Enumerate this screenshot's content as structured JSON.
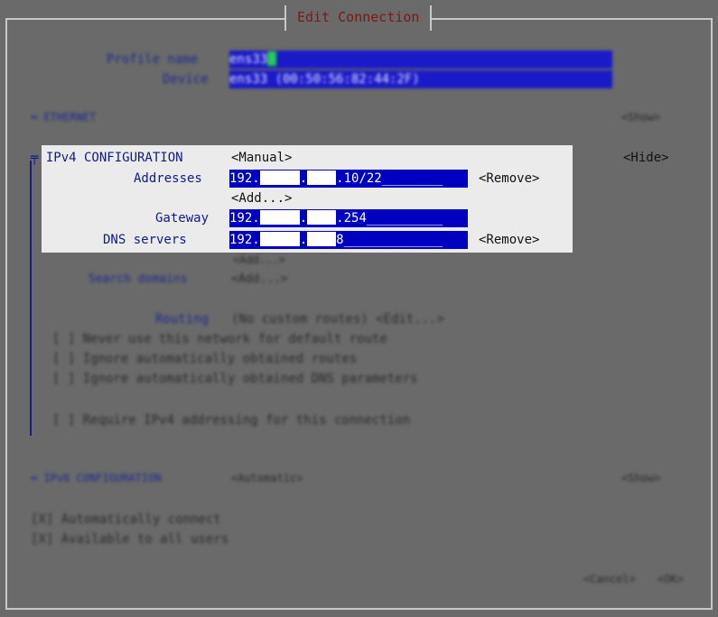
{
  "window": {
    "title": "Edit Connection"
  },
  "profile": {
    "name_label": "Profile name",
    "name_value": "ens33",
    "device_label": "Device",
    "device_value": "ens33 (00:50:56:82:44:2F)"
  },
  "ethernet": {
    "label": "═ ETHERNET",
    "show": "<Show>"
  },
  "ipv4": {
    "label": "╤ IPv4 CONFIGURATION",
    "mode": "<Manual>",
    "hide": "<Hide>",
    "addresses_label": "Addresses",
    "address_prefix": "192.",
    "address_dot": ".",
    "address_suffix": ".10/22________",
    "remove1": "<Remove>",
    "add1": "<Add...>",
    "gateway_label": "Gateway",
    "gateway_prefix": "192.",
    "gateway_dot": ".",
    "gateway_suffix": ".254__________",
    "dns_label": "DNS servers",
    "dns_prefix": "192.",
    "dns_dot": ".",
    "dns_suffix": "8_____________",
    "remove2": "<Remove>",
    "add2": "<Add...>",
    "search_label": "Search domains",
    "search_add": "<Add...>",
    "routing_label": "Routing",
    "routing_value": "(No custom routes) <Edit...>",
    "never_default": "[ ] Never use this network for default route",
    "ignore_routes": "[ ] Ignore automatically obtained routes",
    "ignore_dns": "[ ] Ignore automatically obtained DNS parameters",
    "require_ipv4": "[ ] Require IPv4 addressing for this connection"
  },
  "ipv6": {
    "label": "═ IPv6 CONFIGURATION",
    "mode": "<Automatic>",
    "show": "<Show>"
  },
  "options": {
    "auto_connect": "[X] Automatically connect",
    "all_users": "[X] Available to all users"
  },
  "buttons": {
    "cancel": "<Cancel>",
    "ok": "<OK>"
  }
}
